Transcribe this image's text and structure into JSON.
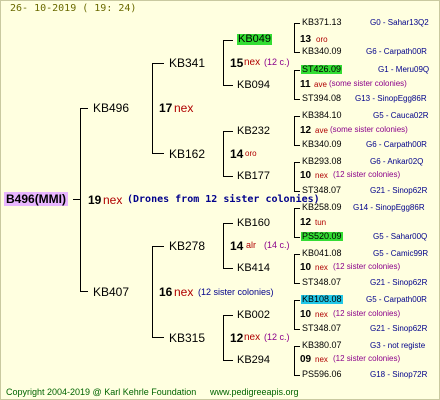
{
  "header": {
    "datetime": "26-  10-2019  (  19:  24)"
  },
  "footer": {
    "copyright": "Copyright 2004-2019 @ Karl Kehrle Foundation",
    "url": "www.pedigreeapis.org"
  },
  "root": {
    "name": "B496(MMI)",
    "count": "19",
    "origin": "nex",
    "note": "(Drones from 12 sister colonies)"
  },
  "gen1": [
    {
      "name": "KB496",
      "count": "17",
      "origin": "nex"
    },
    {
      "name": "KB407",
      "count": "16",
      "origin": "nex",
      "note": "(12 sister colonies)"
    }
  ],
  "gen2": [
    {
      "name": "KB341",
      "count": "15",
      "origin": "nex",
      "note": "(12 c.)"
    },
    {
      "name": "KB162",
      "count": "14",
      "origin": "oro"
    },
    {
      "name": "KB278",
      "count": "14",
      "origin": "alr",
      "note": "(14 c.)"
    },
    {
      "name": "KB315",
      "count": "12",
      "origin": "nex",
      "note": "(12 c.)"
    }
  ],
  "gen3": [
    {
      "name": "KB049",
      "count": "13",
      "origin": "oro",
      "highlight": "green"
    },
    {
      "name": "KB094",
      "count": "11",
      "origin": "ave",
      "note": "(some sister colonies)"
    },
    {
      "name": "KB232",
      "count": "12",
      "origin": "ave",
      "note": "(some sister colonies)"
    },
    {
      "name": "KB177",
      "count": "10",
      "origin": "nex",
      "note": "(12 sister colonies)"
    },
    {
      "name": "KB160",
      "count": "12",
      "origin": "tun"
    },
    {
      "name": "KB414",
      "count": "10",
      "origin": "nex",
      "note": "(12 sister colonies)"
    },
    {
      "name": "KB002",
      "count": "10",
      "origin": "nex",
      "note": "(12 sister colonies)"
    },
    {
      "name": "KB294",
      "count": "09",
      "origin": "nex",
      "note": "(12 sister colonies)"
    }
  ],
  "gen4": [
    {
      "name": "KB371.13",
      "info": "G0 - Sahar13Q2"
    },
    {
      "name": "KB340.09",
      "info": "G6 - Carpath00R"
    },
    {
      "name": "ST426.09",
      "info": "G1 - Meru09Q",
      "highlight": "green"
    },
    {
      "name": "ST394.08",
      "info": "G13 - SinopEgg86R"
    },
    {
      "name": "KB384.10",
      "info": "G5 - Cauca02R"
    },
    {
      "name": "KB340.09",
      "info": "G6 - Carpath00R"
    },
    {
      "name": "KB293.08",
      "info": "G6 - Ankar02Q"
    },
    {
      "name": "ST348.07",
      "info": "G21 - Sinop62R"
    },
    {
      "name": "KB258.09",
      "info": "G14 - SinopEgg86R"
    },
    {
      "name": "PS520.09",
      "info": "G5 - Sahar00Q",
      "highlight": "green"
    },
    {
      "name": "KB041.08",
      "info": "G5 - Camic99R"
    },
    {
      "name": "ST348.07",
      "info": "G21 - Sinop62R"
    },
    {
      "name": "KB108.08",
      "info": "G5 - Carpath00R",
      "highlight": "cyan"
    },
    {
      "name": "ST348.07",
      "info": "G21 - Sinop62R"
    },
    {
      "name": "KB380.07",
      "info": "G3 - not registe"
    },
    {
      "name": "PS596.06",
      "info": "G18 - Sinop72R"
    }
  ]
}
